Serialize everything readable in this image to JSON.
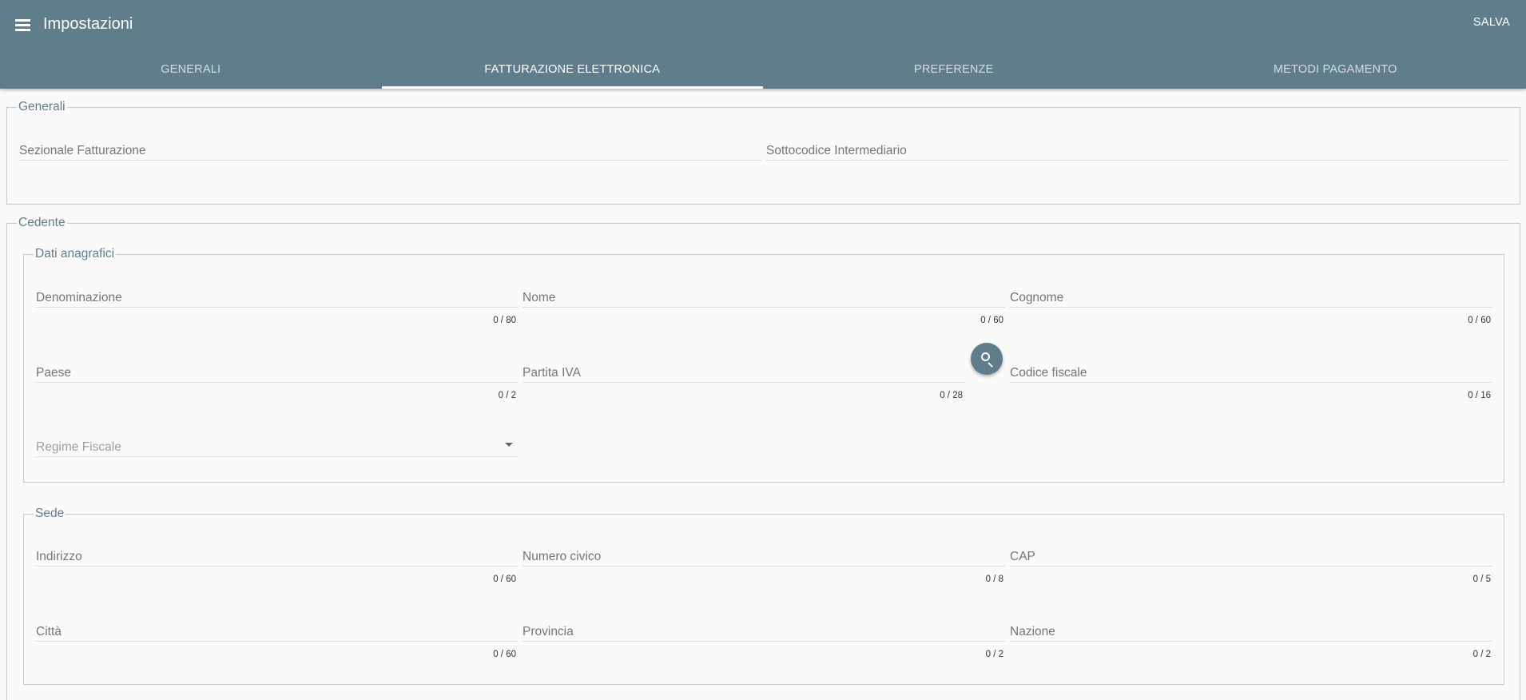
{
  "header": {
    "title": "Impostazioni",
    "save_label": "SALVA"
  },
  "tabs": [
    {
      "label": "GENERALI",
      "active": false
    },
    {
      "label": "FATTURAZIONE ELETTRONICA",
      "active": true
    },
    {
      "label": "PREFERENZE",
      "active": false
    },
    {
      "label": "METODI PAGAMENTO",
      "active": false
    }
  ],
  "generali": {
    "legend": "Generali",
    "sezionale": {
      "label": "Sezionale Fatturazione",
      "value": ""
    },
    "sottocodice": {
      "label": "Sottocodice Intermediario",
      "value": ""
    }
  },
  "cedente": {
    "legend": "Cedente",
    "anagrafica": {
      "legend": "Dati anagrafici",
      "denominazione": {
        "label": "Denominazione",
        "counter": "0 / 80"
      },
      "nome": {
        "label": "Nome",
        "counter": "0 / 60"
      },
      "cognome": {
        "label": "Cognome",
        "counter": "0 / 60"
      },
      "paese": {
        "label": "Paese",
        "counter": "0 / 2"
      },
      "partita_iva": {
        "label": "Partita IVA",
        "counter": "0 / 28"
      },
      "codice_fiscale": {
        "label": "Codice fiscale",
        "counter": "0 / 16"
      },
      "regime_fiscale": {
        "placeholder": "Regime Fiscale",
        "selected": ""
      },
      "search_icon": "search-icon"
    },
    "sede": {
      "legend": "Sede",
      "indirizzo": {
        "label": "Indirizzo",
        "counter": "0 / 60"
      },
      "numero_civico": {
        "label": "Numero civico",
        "counter": "0 / 8"
      },
      "cap": {
        "label": "CAP",
        "counter": "0 / 5"
      },
      "citta": {
        "label": "Città",
        "counter": "0 / 60"
      },
      "provincia": {
        "label": "Provincia",
        "counter": "0 / 2"
      },
      "nazione": {
        "label": "Nazione",
        "counter": "0 / 2"
      }
    }
  },
  "colors": {
    "primary": "#607d8b",
    "background": "#fafafa"
  }
}
